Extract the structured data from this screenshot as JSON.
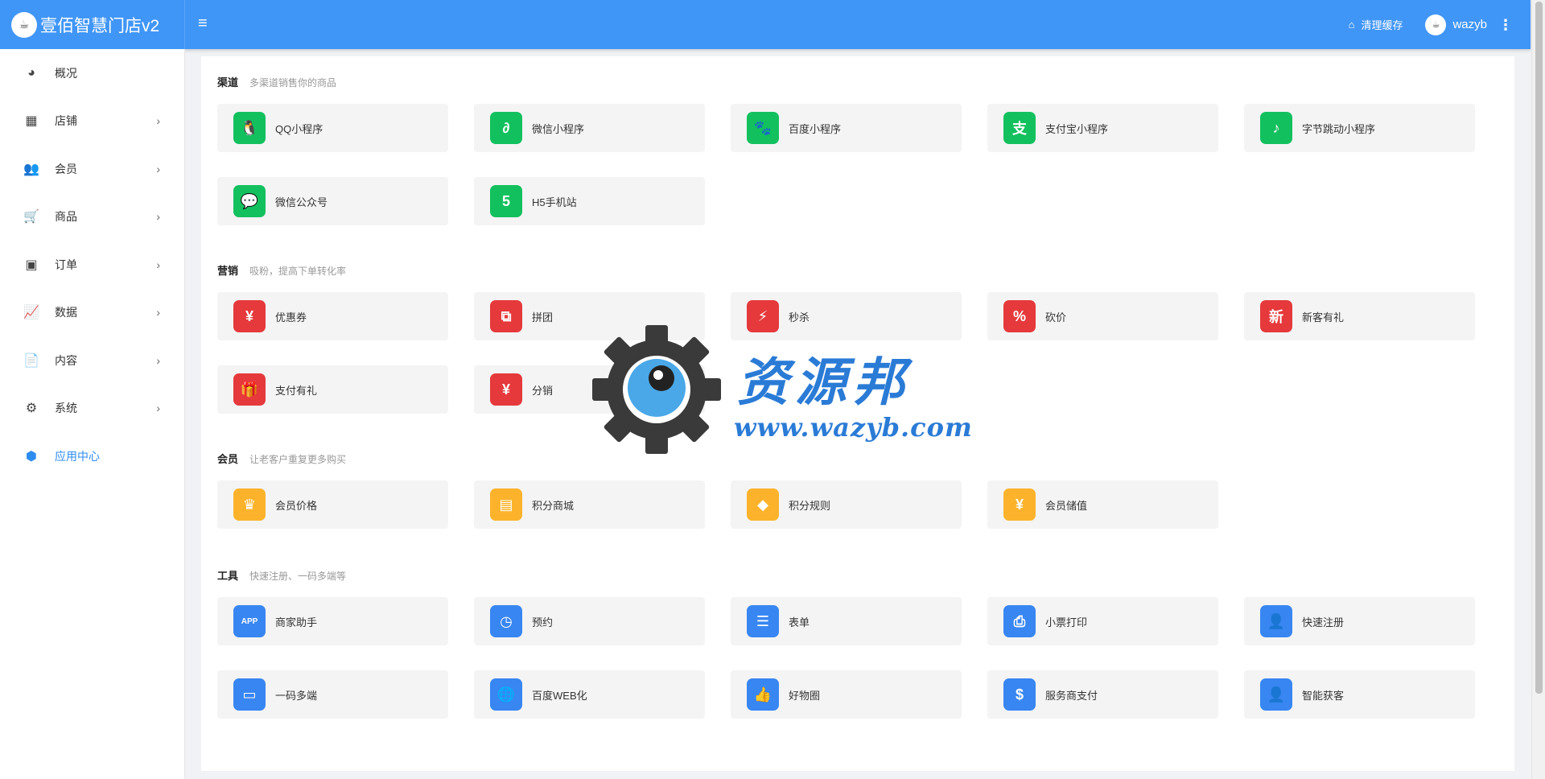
{
  "header": {
    "brand_logo": "☕",
    "brand_title": "壹佰智慧门店v2",
    "menu_icon": "hamburger-icon",
    "clear_cache_label": "清理缓存",
    "user_name": "wazyb",
    "accent_color": "#4096f7"
  },
  "sidebar": {
    "items": [
      {
        "label": "概况",
        "icon": "◕",
        "arrow": ""
      },
      {
        "label": "店铺",
        "icon": "▦",
        "arrow": "›"
      },
      {
        "label": "会员",
        "icon": "👥",
        "arrow": "›"
      },
      {
        "label": "商品",
        "icon": "🛒",
        "arrow": "›"
      },
      {
        "label": "订单",
        "icon": "▣",
        "arrow": "›"
      },
      {
        "label": "数据",
        "icon": "📈",
        "arrow": "›"
      },
      {
        "label": "内容",
        "icon": "📄",
        "arrow": "›"
      },
      {
        "label": "系统",
        "icon": "⚙",
        "arrow": "›"
      },
      {
        "label": "应用中心",
        "icon": "⬢",
        "arrow": ""
      }
    ],
    "active_color": "#2d8cf0"
  },
  "sections": {
    "channels": {
      "title": "渠道",
      "subtitle": "多渠道销售你的商品",
      "items": [
        {
          "label": "QQ小程序",
          "glyph": "🐧"
        },
        {
          "label": "微信小程序",
          "glyph": "∂"
        },
        {
          "label": "百度小程序",
          "glyph": "🐾"
        },
        {
          "label": "支付宝小程序",
          "glyph": "支"
        },
        {
          "label": "字节跳动小程序",
          "glyph": "♪"
        },
        {
          "label": "微信公众号",
          "glyph": "💬"
        },
        {
          "label": "H5手机站",
          "glyph": "5"
        }
      ]
    },
    "marketing": {
      "title": "营销",
      "subtitle": "吸粉，提高下单转化率",
      "items": [
        {
          "label": "优惠券",
          "glyph": "¥"
        },
        {
          "label": "拼团",
          "glyph": "⧉"
        },
        {
          "label": "秒杀",
          "glyph": "⚡"
        },
        {
          "label": "砍价",
          "glyph": "%"
        },
        {
          "label": "新客有礼",
          "glyph": "新"
        },
        {
          "label": "支付有礼",
          "glyph": "🎁"
        },
        {
          "label": "分销",
          "glyph": "¥"
        }
      ]
    },
    "member": {
      "title": "会员",
      "subtitle": "让老客户重复更多购买",
      "items": [
        {
          "label": "会员价格",
          "glyph": "♛"
        },
        {
          "label": "积分商城",
          "glyph": "▤"
        },
        {
          "label": "积分规则",
          "glyph": "◆"
        },
        {
          "label": "会员储值",
          "glyph": "¥"
        }
      ]
    },
    "tools": {
      "title": "工具",
      "subtitle": "快速注册、一码多端等",
      "items": [
        {
          "label": "商家助手",
          "glyph": "APP"
        },
        {
          "label": "预约",
          "glyph": "◷"
        },
        {
          "label": "表单",
          "glyph": "☰"
        },
        {
          "label": "小票打印",
          "glyph": "⎙"
        },
        {
          "label": "快速注册",
          "glyph": "👤"
        },
        {
          "label": "一码多端",
          "glyph": "▭"
        },
        {
          "label": "百度WEB化",
          "glyph": "🌐"
        },
        {
          "label": "好物圈",
          "glyph": "👍"
        },
        {
          "label": "服务商支付",
          "glyph": "$"
        },
        {
          "label": "智能获客",
          "glyph": "👤"
        }
      ]
    }
  },
  "watermark": {
    "name": "资源邦",
    "url": "www.wazyb.com"
  }
}
